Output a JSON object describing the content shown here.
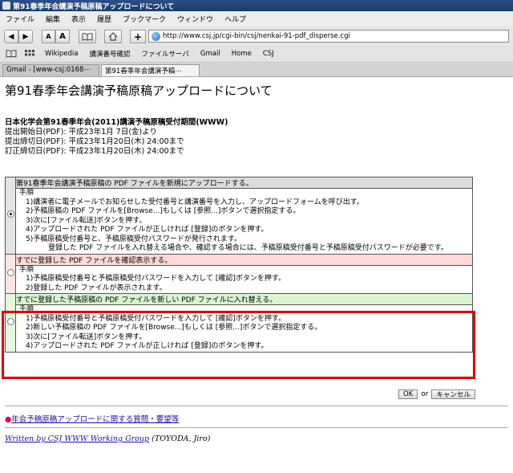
{
  "window": {
    "title": "第91春季年会講演予稿原稿アップロードについて"
  },
  "menu": [
    "ファイル",
    "編集",
    "表示",
    "履歴",
    "ブックマーク",
    "ウィンドウ",
    "ヘルプ"
  ],
  "nav": {
    "font_small": "A",
    "font_large": "A",
    "url": "http://www.csj.jp/cgi-bin/csj/nenkai-91-pdf_disperse.cgi"
  },
  "bookmarks": [
    "Wikipedia",
    "講演番号確認",
    "ファイルサーバ",
    "Gmail",
    "Home",
    "CSJ"
  ],
  "tabs": [
    {
      "label": "Gmail - [www-csj:0168⋯"
    },
    {
      "label": "第91春季年会講演予稿⋯"
    }
  ],
  "page": {
    "title": "第91春季年会講演予稿原稿アップロードについて",
    "period_heading": "日本化学会第91春季年会(2011)講演予稿原稿受付期間(WWW)",
    "period_lines": [
      "提出開始日(PDF): 平成23年1月 7日(金)より",
      "提出締切日(PDF): 平成23年1月20日(木) 24:00まで",
      "訂正締切日(PDF): 平成23年1月20日(木) 24:00まで"
    ],
    "options": [
      {
        "heading": "第91春季年会講演予稿原稿の PDF ファイルを新規にアップロードする。",
        "head_color": "#dcdcdc",
        "steps_title": "手順",
        "steps": [
          "1)講演者に電子メールでお知らせした受付番号と講演番号を入力し、アップロードフォームを呼び出す。",
          "2)予稿原稿の PDF ファイルを[Browse...]もしくは [参照...]ボタンで選択指定する。",
          "3)次に[ファイル転送]ボタンを押す。",
          "4)アップロードされた PDF ファイルが正しければ [登録]のボタンを押す。",
          "5)予稿原稿受付番号と、予稿原稿受付パスワードが発行されます。"
        ],
        "note": "登録した PDF ファイルを入れ替える場合や、確認する場合には、予稿原稿受付番号と予稿原稿受付パスワードが必要です。"
      },
      {
        "heading": "すでに登録した PDF ファイルを確認表示する。",
        "head_color": "#ffd9d9",
        "steps_title": "手順",
        "steps": [
          "1)予稿原稿受付番号と予稿原稿受付パスワードを入力して [確認]ボタンを押す。",
          "2)登録した PDF ファイルが表示されます。"
        ]
      },
      {
        "heading": "すでに登録した予稿原稿の PDF ファイルを新しい PDF ファイルに入れ替える。",
        "head_color": "#d8f5d0",
        "steps_title": "手順",
        "steps": [
          "1)予稿原稿受付番号と予稿原稿受付パスワードを入力して [確認]ボタンを押す。",
          "2)新しい予稿原稿の PDF ファイルを[Browse...]もしくは [参照...]ボタンで選択指定する。",
          "3)次に[ファイル転送]ボタンを押す。",
          "4)アップロードされた PDF ファイルが正しければ [登録]のボタンを押す。"
        ]
      }
    ],
    "ok_label": "OK",
    "or_text": "or",
    "cancel_label": "キャンセル",
    "faq_link": "年会予稿原稿アップロードに関する質問・要望等",
    "credit_link": "Written by CSJ WWW Working Group",
    "credit_suffix": " (TOYODA, Jiro)"
  }
}
